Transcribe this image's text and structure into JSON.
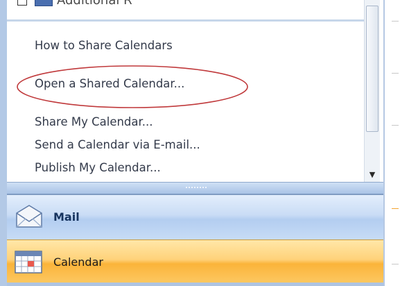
{
  "navigation_pane": {
    "top_item": {
      "text": "Additional R"
    },
    "calendar_links": [
      {
        "label": "How to Share Calendars",
        "highlighted": false
      },
      {
        "label": "Open a Shared Calendar...",
        "highlighted": true
      },
      {
        "label": "Share My Calendar...",
        "highlighted": false
      },
      {
        "label": "Send a Calendar via E-mail...",
        "highlighted": false
      },
      {
        "label": "Publish My Calendar...",
        "highlighted": false
      }
    ],
    "highlight_color": "#c0393b",
    "nav_buttons": [
      {
        "label": "Mail",
        "icon": "mail-icon",
        "selected": false
      },
      {
        "label": "Calendar",
        "icon": "calendar-icon",
        "selected": true
      }
    ]
  },
  "colors": {
    "link_text": "#333a4a",
    "selected_tab": "#fbb43a",
    "pane_border": "#b3c9e6"
  }
}
